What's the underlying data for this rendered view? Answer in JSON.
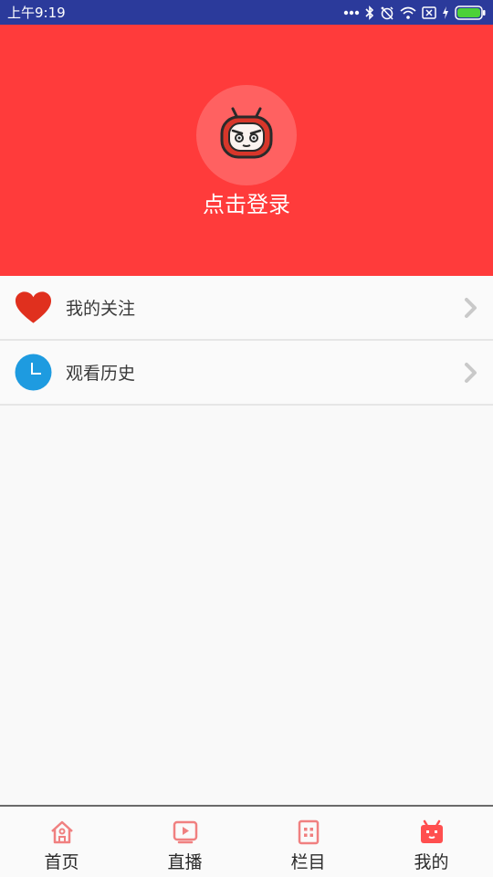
{
  "status_bar": {
    "time": "上午9:19",
    "icons": [
      "more-dots-icon",
      "bluetooth-icon",
      "alarm-off-icon",
      "wifi-icon",
      "no-sim-icon",
      "charging-icon",
      "battery-icon"
    ],
    "battery_color": "#4cd137"
  },
  "header": {
    "background": "#ff3b3b",
    "avatar_icon": "tv-mascot-icon",
    "login_label": "点击登录"
  },
  "menu": {
    "items": [
      {
        "label": "我的关注",
        "icon": "heart-icon",
        "icon_color": "#e0301e"
      },
      {
        "label": "观看历史",
        "icon": "clock-icon",
        "icon_color": "#1e9be0"
      }
    ]
  },
  "bottom_nav": {
    "items": [
      {
        "label": "首页",
        "icon": "home-icon",
        "active": false
      },
      {
        "label": "直播",
        "icon": "live-icon",
        "active": false
      },
      {
        "label": "栏目",
        "icon": "columns-icon",
        "active": false
      },
      {
        "label": "我的",
        "icon": "tv-mine-icon",
        "active": true
      }
    ],
    "icon_color": "#f08080",
    "active_icon_color": "#ff4f4f"
  }
}
